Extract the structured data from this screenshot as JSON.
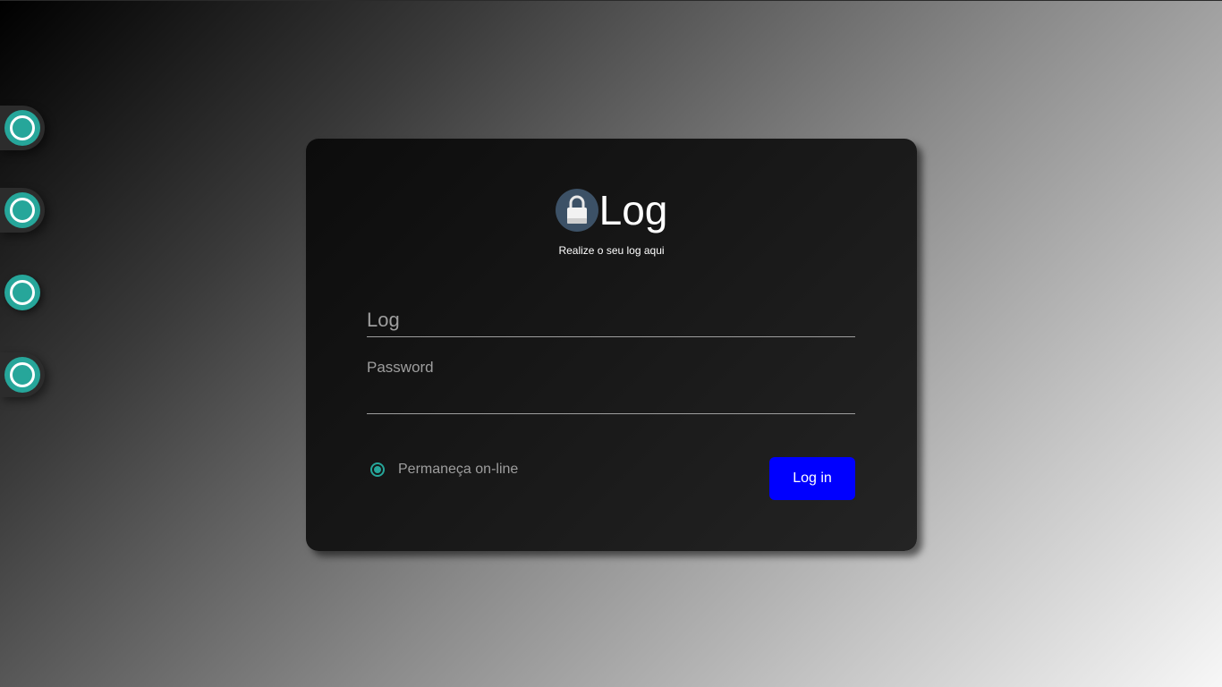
{
  "colors": {
    "accent": "#26a69a",
    "button": "#0000ff",
    "card": "#181818",
    "lock_badge": "#3c5166"
  },
  "side_nav": {
    "items": [
      {
        "icon": "circle-icon"
      },
      {
        "icon": "circle-icon"
      },
      {
        "icon": "circle-icon"
      },
      {
        "icon": "circle-icon"
      }
    ]
  },
  "login": {
    "icon": "lock-icon",
    "title": "Log",
    "subtitle": "Realize o seu log aqui",
    "log_field": {
      "placeholder": "Log",
      "value": ""
    },
    "password_field": {
      "label": "Password",
      "value": ""
    },
    "stay_online": {
      "label": "Permaneça on-line",
      "checked": true
    },
    "submit_label": "Log in"
  }
}
